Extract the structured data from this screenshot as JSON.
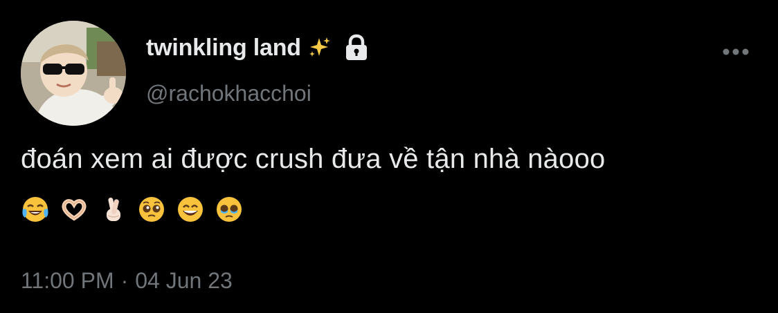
{
  "user": {
    "display_name": "twinkling land",
    "handle": "@rachokhacchoi",
    "name_emoji_icon": "sparkles-icon",
    "protected_icon": "lock-icon",
    "avatar_alt": "child with sunglasses giving thumbs up"
  },
  "tweet": {
    "text": "đoán xem ai được crush đưa về tận nhà nàooo",
    "emojis": [
      "face-with-tears-of-joy-icon",
      "heart-hands-icon",
      "fingers-crossed-icon",
      "pleading-face-icon",
      "grinning-face-icon",
      "face-holding-back-tears-icon"
    ],
    "time": "11:00 PM",
    "separator": "·",
    "date": "04 Jun 23"
  },
  "menu": {
    "more_icon": "more-dots-icon"
  },
  "colors": {
    "background": "#000000",
    "primary_text": "#e7e9ea",
    "secondary_text": "#71767b"
  }
}
